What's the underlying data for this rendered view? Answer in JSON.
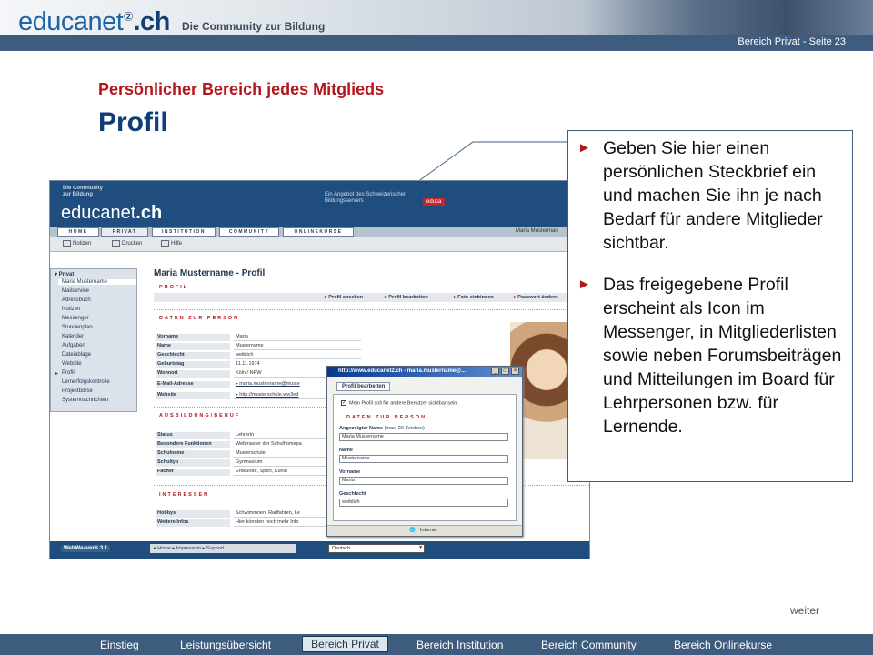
{
  "header": {
    "logo_text": "educanet",
    "logo_sup": "②",
    "logo_suffix": ".ch",
    "tagline": "Die Community zur Bildung",
    "page_label": "Bereich Privat  - Seite 23"
  },
  "slide": {
    "subtitle": "Persönlicher Bereich jedes Mitglieds",
    "title": "Profil"
  },
  "callout": {
    "bullets": [
      "Geben Sie hier einen persönlichen Steckbrief ein und machen Sie ihn je nach Bedarf für andere Mitglieder sichtbar.",
      "Das freigegebene Profil erscheint als Icon im Messenger, in Mitgliederlisten sowie neben Forumsbeiträgen und Mitteilungen im Board für Lehrpersonen bzw. für Lernende."
    ]
  },
  "screenshot": {
    "head": {
      "community": "Die Community zur Bildung",
      "logo_text": "educanet",
      "logo_suffix": ".ch",
      "angebot": "Ein Angebot des Schweizerischen Bildungsservers",
      "educa": "educa"
    },
    "nav": [
      "HOME",
      "PRIVAT",
      "INSTITUTION",
      "COMMUNITY",
      "ONLINEKURSE"
    ],
    "user": "Maria Musterman",
    "toolbar": [
      "Notizen",
      "Drucken",
      "Hilfe"
    ],
    "sidebar": {
      "header": "Privat",
      "items": [
        "Maria Mustername",
        "Mailservice",
        "Adressbuch",
        "Notizen",
        "Messenger",
        "Stundenplan",
        "Kalender",
        "Aufgaben",
        "Dateiablage",
        "Website",
        "Profil",
        "Lernerfolgskontrolle",
        "Projektbörse",
        "Systemnachrichten"
      ]
    },
    "main_title": "Maria Mustername - Profil",
    "section_profil": "PROFIL",
    "actions": [
      "Profil ansehen",
      "Profil bearbeiten",
      "Foto einbinden",
      "Passwort ändern"
    ],
    "section_person": "DATEN ZUR PERSON",
    "person": [
      [
        "Vorname",
        "Maria"
      ],
      [
        "Name",
        "Mustername"
      ],
      [
        "Geschlecht",
        "weiblich"
      ],
      [
        "Geburtstag",
        "11.11.1974"
      ],
      [
        "Wohnort",
        "Köln / NRW"
      ],
      [
        "E-Mail-Adresse",
        "▸ maria.mustername@muste"
      ],
      [
        "Website",
        "▸ http://musterschule.ww3ed"
      ]
    ],
    "section_ausbildung": "AUSBILDUNG/BERUF",
    "ausbildung": [
      [
        "Status",
        "Lehrerin"
      ],
      [
        "Besondere Funktionen",
        "Webmaster der Schulhomepa"
      ],
      [
        "Schulname",
        "Musterschule"
      ],
      [
        "Schultyp",
        "Gymnasium"
      ],
      [
        "Fächer",
        "Erdkunde, Sport, Kunst"
      ]
    ],
    "section_interessen": "INTERESSEN",
    "interessen": [
      [
        "Hobbys",
        "Schwimmnen, Radfahren, Le"
      ],
      [
        "Weitere Infos",
        "Hier könnten noch mehr Info"
      ]
    ],
    "footer": {
      "webweaver": "WebWeaver® 3.1",
      "links": "▸ Home   ▸ Impressum   ▸ Support",
      "sprache": "Deutsch"
    }
  },
  "popup": {
    "title": "http://www.educanet2.ch - maria.mustername@...",
    "tab": "Profil bearbeiten",
    "checkbox_label": "Mein Profil soll für andere Benutzer sichtbar sein.",
    "section": "DATEN ZUR PERSON",
    "fields": [
      {
        "label": "Angezeigter Name",
        "hint": "(max. 20 Zeichen)",
        "value": "Maria Mustername"
      },
      {
        "label": "Name",
        "hint": "",
        "value": "Mustername"
      },
      {
        "label": "Vorname",
        "hint": "",
        "value": "Maria"
      },
      {
        "label": "Geschlecht",
        "hint": "",
        "value": "weiblich"
      }
    ],
    "status": "Internet"
  },
  "weiter": "weiter",
  "bottom_nav": {
    "items": [
      "Einstieg",
      "Leistungsübersicht",
      "Bereich Privat",
      "Bereich Institution",
      "Bereich Community",
      "Bereich Onlinekurse"
    ],
    "active": "Bereich Privat"
  }
}
